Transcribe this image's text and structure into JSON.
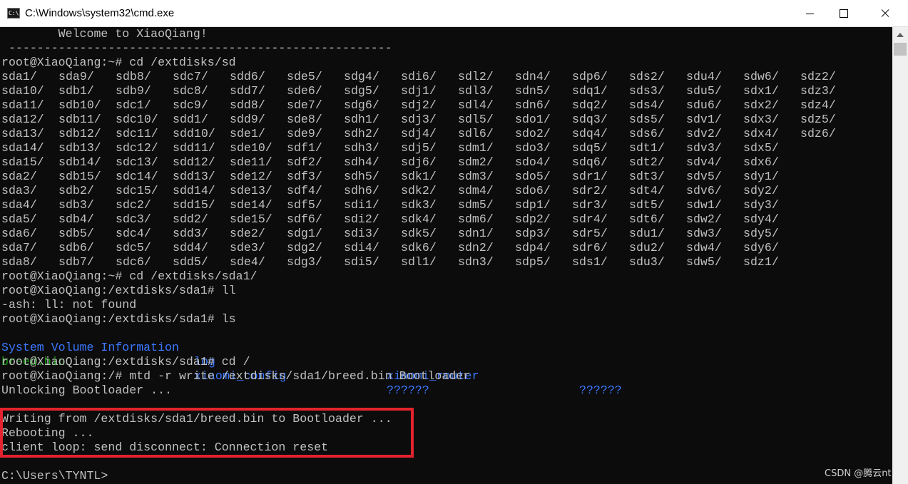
{
  "window": {
    "title": "C:\\Windows\\system32\\cmd.exe",
    "icon": "cmd-icon",
    "icon_text": "C:\\"
  },
  "colors": {
    "background": "#0c0c0c",
    "text": "#c0c0c0",
    "blue": "#3b78ff",
    "green": "#13a10e",
    "highlight": "#e3232d"
  },
  "terminal": {
    "welcome": "        Welcome to XiaoQiang!",
    "rule": " ------------------------------------------------------",
    "cmd1": "root@XiaoQiang:~# cd /extdisks/sd",
    "listing": [
      [
        "sda1/",
        "sda9/",
        "sdb8/",
        "sdc7/",
        "sdd6/",
        "sde5/",
        "sdg4/",
        "sdi6/",
        "sdl2/",
        "sdn4/",
        "sdp6/",
        "sds2/",
        "sdu4/",
        "sdw6/",
        "sdz2/"
      ],
      [
        "sda10/",
        "sdb1/",
        "sdb9/",
        "sdc8/",
        "sdd7/",
        "sde6/",
        "sdg5/",
        "sdj1/",
        "sdl3/",
        "sdn5/",
        "sdq1/",
        "sds3/",
        "sdu5/",
        "sdx1/",
        "sdz3/"
      ],
      [
        "sda11/",
        "sdb10/",
        "sdc1/",
        "sdc9/",
        "sdd8/",
        "sde7/",
        "sdg6/",
        "sdj2/",
        "sdl4/",
        "sdn6/",
        "sdq2/",
        "sds4/",
        "sdu6/",
        "sdx2/",
        "sdz4/"
      ],
      [
        "sda12/",
        "sdb11/",
        "sdc10/",
        "sdd1/",
        "sdd9/",
        "sde8/",
        "sdh1/",
        "sdj3/",
        "sdl5/",
        "sdo1/",
        "sdq3/",
        "sds5/",
        "sdv1/",
        "sdx3/",
        "sdz5/"
      ],
      [
        "sda13/",
        "sdb12/",
        "sdc11/",
        "sdd10/",
        "sde1/",
        "sde9/",
        "sdh2/",
        "sdj4/",
        "sdl6/",
        "sdo2/",
        "sdq4/",
        "sds6/",
        "sdv2/",
        "sdx4/",
        "sdz6/"
      ],
      [
        "sda14/",
        "sdb13/",
        "sdc12/",
        "sdd11/",
        "sde10/",
        "sdf1/",
        "sdh3/",
        "sdj5/",
        "sdm1/",
        "sdo3/",
        "sdq5/",
        "sdt1/",
        "sdv3/",
        "sdx5/"
      ],
      [
        "sda15/",
        "sdb14/",
        "sdc13/",
        "sdd12/",
        "sde11/",
        "sdf2/",
        "sdh4/",
        "sdj6/",
        "sdm2/",
        "sdo4/",
        "sdq6/",
        "sdt2/",
        "sdv4/",
        "sdx6/"
      ],
      [
        "sda2/",
        "sdb15/",
        "sdc14/",
        "sdd13/",
        "sde12/",
        "sdf3/",
        "sdh5/",
        "sdk1/",
        "sdm3/",
        "sdo5/",
        "sdr1/",
        "sdt3/",
        "sdv5/",
        "sdy1/"
      ],
      [
        "sda3/",
        "sdb2/",
        "sdc15/",
        "sdd14/",
        "sde13/",
        "sdf4/",
        "sdh6/",
        "sdk2/",
        "sdm4/",
        "sdo6/",
        "sdr2/",
        "sdt4/",
        "sdv6/",
        "sdy2/"
      ],
      [
        "sda4/",
        "sdb3/",
        "sdc2/",
        "sdd15/",
        "sde14/",
        "sdf5/",
        "sdi1/",
        "sdk3/",
        "sdm5/",
        "sdp1/",
        "sdr3/",
        "sdt5/",
        "sdw1/",
        "sdy3/"
      ],
      [
        "sda5/",
        "sdb4/",
        "sdc3/",
        "sdd2/",
        "sde15/",
        "sdf6/",
        "sdi2/",
        "sdk4/",
        "sdm6/",
        "sdp2/",
        "sdr4/",
        "sdt6/",
        "sdw2/",
        "sdy4/"
      ],
      [
        "sda6/",
        "sdb5/",
        "sdc4/",
        "sdd3/",
        "sde2/",
        "sdg1/",
        "sdi3/",
        "sdk5/",
        "sdn1/",
        "sdp3/",
        "sdr5/",
        "sdu1/",
        "sdw3/",
        "sdy5/"
      ],
      [
        "sda7/",
        "sdb6/",
        "sdc5/",
        "sdd4/",
        "sde3/",
        "sdg2/",
        "sdi4/",
        "sdk6/",
        "sdn2/",
        "sdp4/",
        "sdr6/",
        "sdu2/",
        "sdw4/",
        "sdy6/"
      ],
      [
        "sda8/",
        "sdb7/",
        "sdc6/",
        "sdd5/",
        "sde4/",
        "sdg3/",
        "sdi5/",
        "sdl1/",
        "sdn3/",
        "sdp5/",
        "sds1/",
        "sdu3/",
        "sdw5/",
        "sdz1/"
      ]
    ],
    "cmd2": "root@XiaoQiang:~# cd /extdisks/sda1/",
    "cmd3": "root@XiaoQiang:/extdisks/sda1# ll",
    "err": "-ash: ll: not found",
    "cmd4": "root@XiaoQiang:/extdisks/sda1# ls",
    "ls_row1": {
      "a": "System Volume Information",
      "b": "log",
      "c": "xiaomi_router",
      "d": "??????"
    },
    "ls_row2": {
      "a": "breed.bin",
      "b": "xiaomi_config",
      "c": "??????"
    },
    "cmd5": "root@XiaoQiang:/extdisks/sda1# cd /",
    "cmd6": "root@XiaoQiang:/# mtd -r write /extdisks/sda1/breed.bin Bootloader",
    "out1": "Unlocking Bootloader ...",
    "out2": "Writing from /extdisks/sda1/breed.bin to Bootloader ...",
    "out3": "Rebooting ...",
    "out4": "client loop: send disconnect: Connection reset",
    "prompt": "C:\\Users\\TYNTL>"
  },
  "watermark": "CSDN @腾云nt"
}
